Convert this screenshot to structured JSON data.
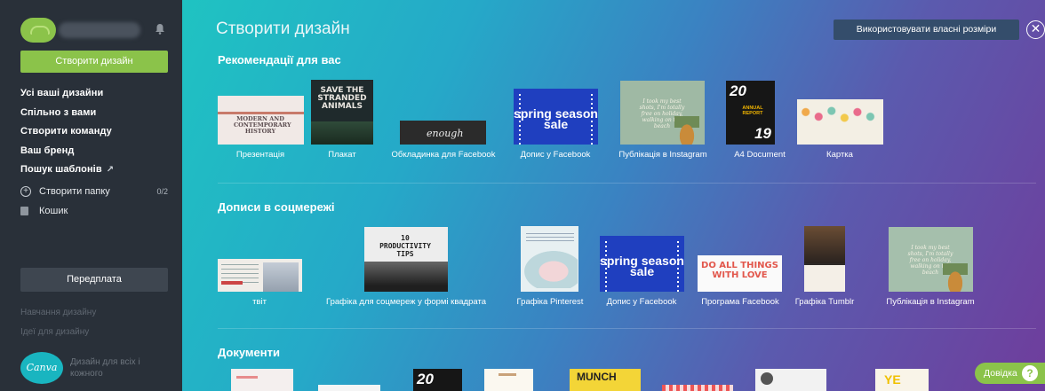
{
  "sidebar": {
    "create_button": "Створити дизайн",
    "nav": [
      {
        "label": "Усі ваші дизайни"
      },
      {
        "label": "Спільно з вами"
      },
      {
        "label": "Створити команду"
      },
      {
        "label": "Ваш бренд"
      },
      {
        "label": "Пошук шаблонів",
        "ext_icon": "↗"
      }
    ],
    "create_folder": "Створити папку",
    "folder_count": "0/2",
    "trash": "Кошик",
    "subscription_button": "Передплата",
    "design_school": "Навчання дизайну",
    "design_ideas": "Ідеї для дизайну",
    "logo_text": "Canva",
    "tagline": "Дизайн для всіх і кожного"
  },
  "main": {
    "title": "Створити дизайн",
    "custom_size_button": "Використовувати власні розміри",
    "close_icon": "✕",
    "sections": [
      {
        "title": "Рекомендації для вас",
        "items": [
          {
            "label": "Презентація",
            "thumb_text": "MODERN AND CONTEMPORARY HISTORY"
          },
          {
            "label": "Плакат",
            "thumb_text": "SAVE THE STRANDED ANIMALS"
          },
          {
            "label": "Обкладинка для Facebook",
            "thumb_text": "enough"
          },
          {
            "label": "Допис у Facebook",
            "thumb_text": "spring season sale"
          },
          {
            "label": "Публікація в Instagram",
            "thumb_text": "I took my best shots, I'm totally free on holiday, walking on the beach"
          },
          {
            "label": "A4 Document",
            "thumb_text": "ANNUAL REPORT",
            "thumb_num_top": "20",
            "thumb_num_bottom": "19"
          },
          {
            "label": "Картка"
          }
        ]
      },
      {
        "title": "Дописи в соцмережі",
        "items": [
          {
            "label": "твіт"
          },
          {
            "label": "Графіка для соцмереж у формі квадрата",
            "thumb_text": "10 PRODUCTIVITY TIPS"
          },
          {
            "label": "Графіка Pinterest"
          },
          {
            "label": "Допис у Facebook",
            "thumb_text": "spring season sale"
          },
          {
            "label": "Програма Facebook",
            "thumb_text": "DO ALL THINGS WITH LOVE"
          },
          {
            "label": "Графіка Tumblr"
          },
          {
            "label": "Публікація в Instagram",
            "thumb_text": "I took my best shots, I'm totally free on holiday, walking on the beach"
          }
        ]
      },
      {
        "title": "Документи",
        "items": [
          {
            "thumb_text": ""
          },
          {
            "thumb_text": ""
          },
          {
            "thumb_text": "20"
          },
          {
            "thumb_text": ""
          },
          {
            "thumb_text": "MUNCH"
          },
          {
            "thumb_text": ""
          },
          {
            "thumb_text": ""
          },
          {
            "thumb_text": "YE"
          }
        ]
      }
    ]
  },
  "help_button": "Довідка",
  "help_icon": "?"
}
